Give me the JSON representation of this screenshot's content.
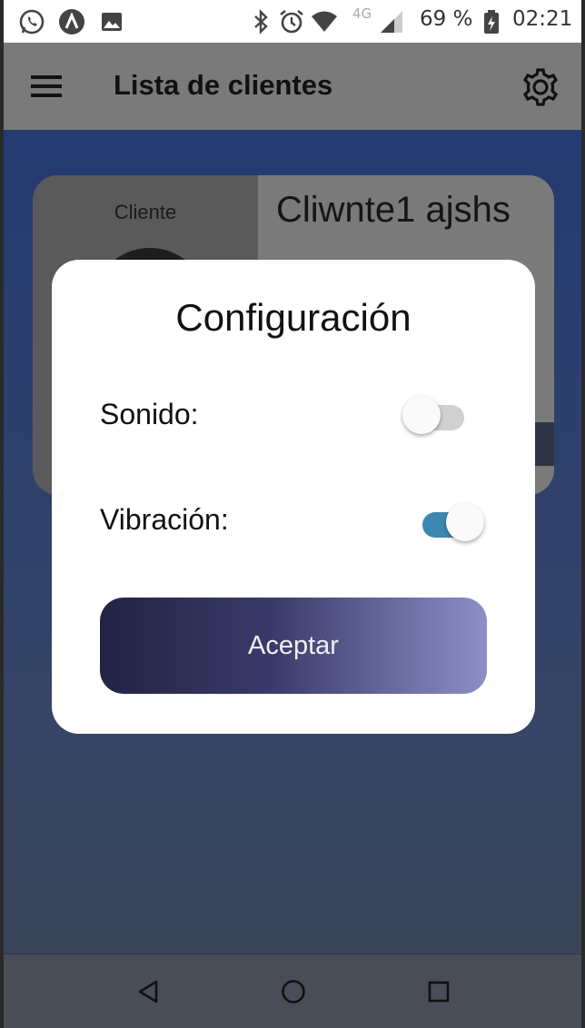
{
  "status_bar": {
    "icons_left": [
      "whatsapp-icon",
      "app-a-icon",
      "image-icon"
    ],
    "icons_right": [
      "bluetooth-icon",
      "alarm-icon",
      "wifi-icon",
      "signal-icon",
      "battery-icon"
    ],
    "network": "4G",
    "battery": "69 %",
    "time": "02:21"
  },
  "app_bar": {
    "title": "Lista de clientes",
    "menu_icon": "hamburger-menu-icon",
    "settings_icon": "gear-icon"
  },
  "client_card": {
    "caption": "Cliente",
    "name": "Cliwnte1 ajshs"
  },
  "dialog": {
    "title": "Configuración",
    "sound_label": "Sonido:",
    "sound_enabled": false,
    "vibration_label": "Vibración:",
    "vibration_enabled": true,
    "accept_label": "Aceptar"
  },
  "nav_bar": {
    "buttons": [
      "back-icon",
      "home-icon",
      "recents-icon"
    ]
  },
  "colors": {
    "toggle_on": "#3d88b0",
    "toggle_off": "#d0d0d0",
    "button_gradient_start": "#222244",
    "button_gradient_end": "#8b90c6"
  }
}
